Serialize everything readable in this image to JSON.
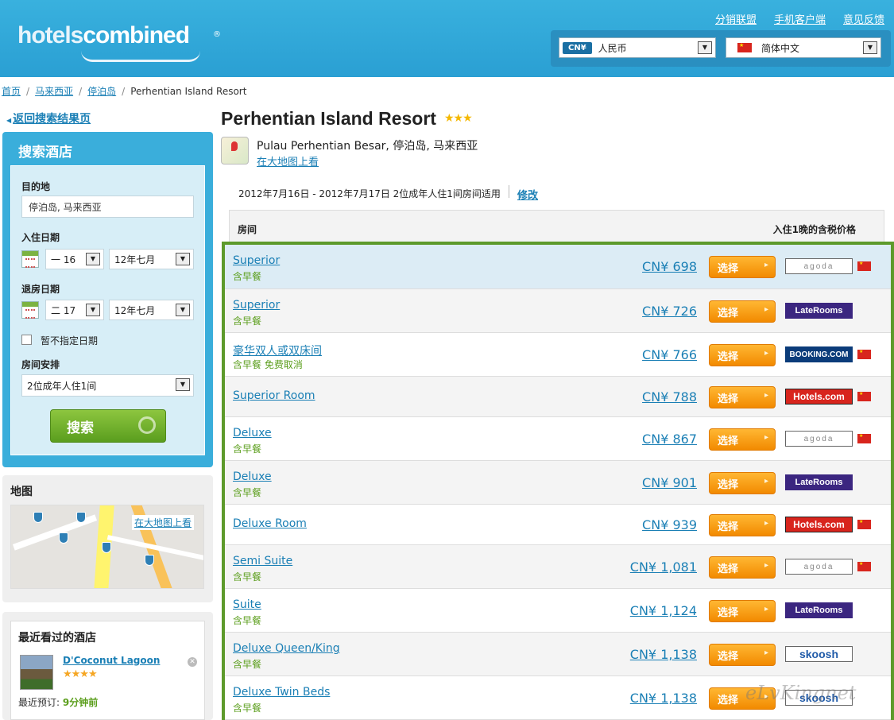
{
  "header": {
    "logo_part1": "hotels",
    "logo_part2": "combined",
    "logo_reg": "®",
    "links": [
      "分销联盟",
      "手机客户端",
      "意见反馈"
    ],
    "currency_code": "CN¥",
    "currency_label": "人民币",
    "language_label": "简体中文"
  },
  "breadcrumb": [
    "首页",
    "马来西亚",
    "停泊岛",
    "Perhentian Island Resort"
  ],
  "sidebar": {
    "back_link": "返回搜索结果页",
    "search_title": "搜索酒店",
    "destination_label": "目的地",
    "destination_value": "停泊岛, 马来西亚",
    "checkin_label": "入住日期",
    "checkin_day": "一 16",
    "checkin_month": "12年七月",
    "checkout_label": "退房日期",
    "checkout_day": "二 17",
    "checkout_month": "12年七月",
    "no_date_label": "暂不指定日期",
    "rooms_label": "房间安排",
    "rooms_value": "2位成年人住1间",
    "search_button": "搜索",
    "map_title": "地图",
    "map_link": "在大地图上看",
    "recent_title": "最近看过的酒店",
    "recent_hotel_name": "D'Coconut Lagoon",
    "recent_hotel_stars": "★★★★",
    "recent_booked_label": "最近预订:",
    "recent_booked_time": "9分钟前"
  },
  "hotel": {
    "name": "Perhentian Island Resort",
    "stars": "★★★",
    "address": "Pulau Perhentian Besar, 停泊岛, 马来西亚",
    "map_link": "在大地图上看",
    "dates_text": "2012年7月16日 - 2012年7月17日 2位成年人住1间房间适用",
    "modify_link": "修改"
  },
  "table": {
    "col_room": "房间",
    "col_price": "入住1晚的含税价格",
    "select_label": "选择"
  },
  "rooms": [
    {
      "name": "Superior",
      "sub": "含早餐",
      "price": "CN¥ 698",
      "provider": "agoda",
      "provider_label": "agoda",
      "flag": true
    },
    {
      "name": "Superior",
      "sub": "含早餐",
      "price": "CN¥ 726",
      "provider": "laterooms",
      "provider_label": "LateRooms",
      "flag": false
    },
    {
      "name": "豪华双人或双床间",
      "sub": "含早餐 免费取消",
      "price": "CN¥ 766",
      "provider": "booking",
      "provider_label": "BOOKING.COM",
      "flag": true
    },
    {
      "name": "Superior Room",
      "sub": "",
      "price": "CN¥ 788",
      "provider": "hotels",
      "provider_label": "Hotels.com",
      "flag": true
    },
    {
      "name": "Deluxe",
      "sub": "含早餐",
      "price": "CN¥ 867",
      "provider": "agoda",
      "provider_label": "agoda",
      "flag": true
    },
    {
      "name": "Deluxe",
      "sub": "含早餐",
      "price": "CN¥ 901",
      "provider": "laterooms",
      "provider_label": "LateRooms",
      "flag": false
    },
    {
      "name": "Deluxe Room",
      "sub": "",
      "price": "CN¥ 939",
      "provider": "hotels",
      "provider_label": "Hotels.com",
      "flag": true
    },
    {
      "name": "Semi Suite",
      "sub": "含早餐",
      "price": "CN¥ 1,081",
      "provider": "agoda",
      "provider_label": "agoda",
      "flag": true
    },
    {
      "name": "Suite",
      "sub": "含早餐",
      "price": "CN¥ 1,124",
      "provider": "laterooms",
      "provider_label": "LateRooms",
      "flag": false
    },
    {
      "name": "Deluxe Queen/King",
      "sub": "含早餐",
      "price": "CN¥ 1,138",
      "provider": "skoosh",
      "provider_label": "skoosh",
      "flag": false
    },
    {
      "name": "Deluxe Twin Beds",
      "sub": "含早餐",
      "price": "CN¥ 1,138",
      "provider": "skoosh",
      "provider_label": "skoosh",
      "flag": false
    }
  ],
  "watermark": "eLvKingnet",
  "colors": {
    "header": "#2a9fd3",
    "accent_green": "#5d9a2b",
    "select_orange": "#f28a00",
    "link": "#1a7fb5"
  }
}
